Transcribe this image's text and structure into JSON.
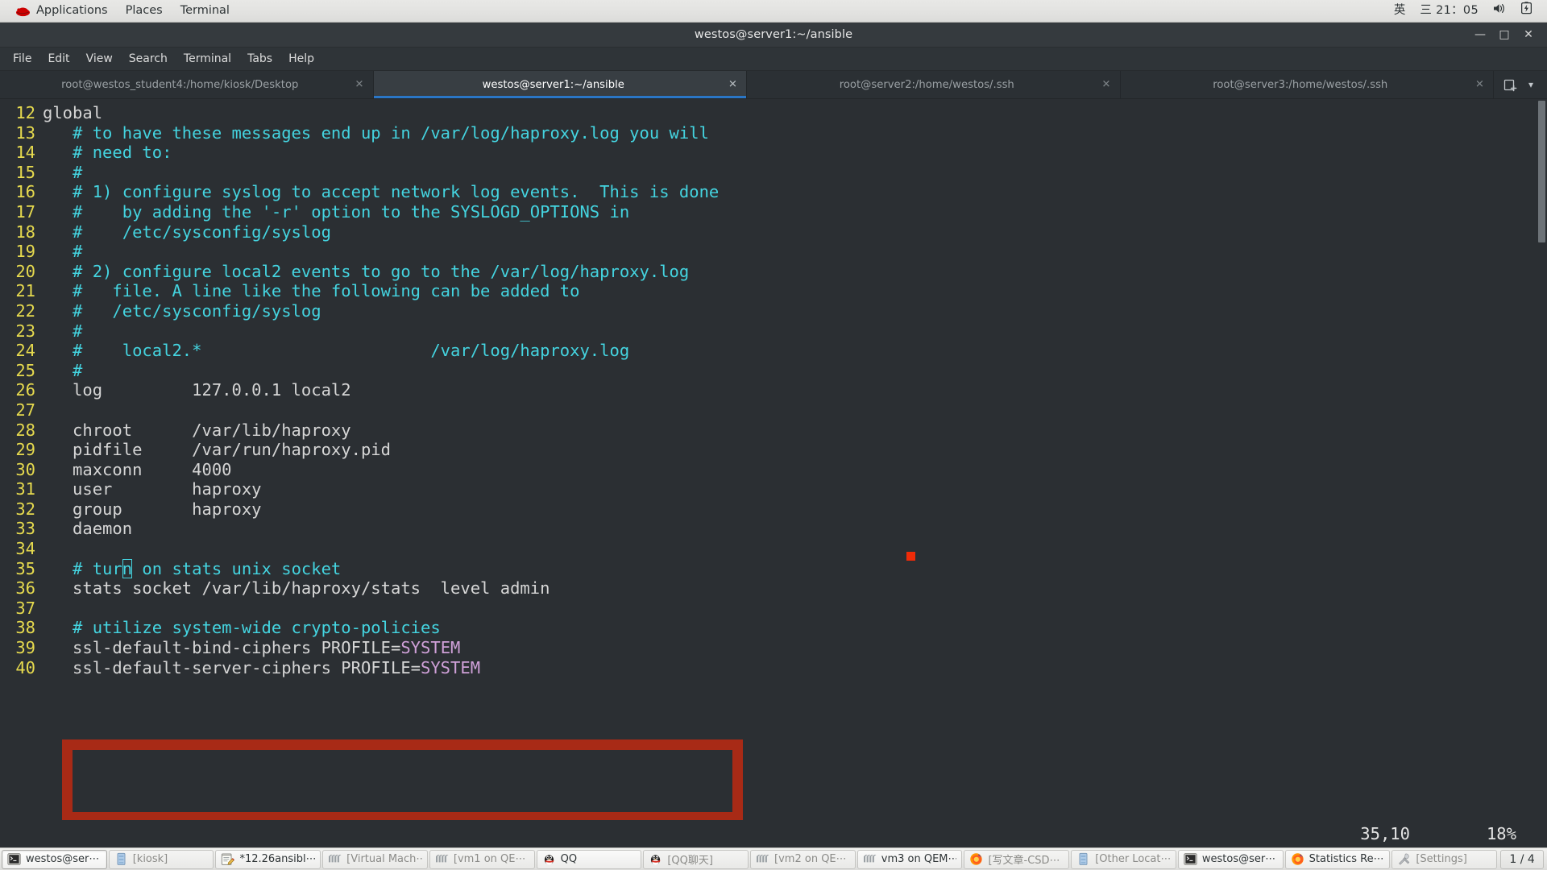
{
  "gnome_panel": {
    "left_items": [
      {
        "label": "Applications",
        "icon": "redhat-logo-icon"
      },
      {
        "label": "Places",
        "icon": null
      },
      {
        "label": "Terminal",
        "icon": null
      }
    ],
    "right_items": [
      {
        "label": "英",
        "icon": "input-method-icon"
      },
      {
        "label": "三 21：05",
        "icon": "calendar-clock-icon"
      },
      {
        "label": "",
        "icon": "volume-icon"
      },
      {
        "label": "",
        "icon": "battery-icon"
      }
    ]
  },
  "window": {
    "title": "westos@server1:~/ansible",
    "buttons": [
      {
        "name": "minimize",
        "glyph": "—"
      },
      {
        "name": "maximize",
        "glyph": "□"
      },
      {
        "name": "close",
        "glyph": "✕"
      }
    ]
  },
  "menubar": {
    "items": [
      "File",
      "Edit",
      "View",
      "Search",
      "Terminal",
      "Tabs",
      "Help"
    ]
  },
  "tabs": {
    "close_glyph": "✕",
    "items": [
      {
        "label": "root@westos_student4:/home/kiosk/Desktop",
        "active": false
      },
      {
        "label": "westos@server1:~/ansible",
        "active": true
      },
      {
        "label": "root@server2:/home/westos/.ssh",
        "active": false
      },
      {
        "label": "root@server3:/home/westos/.ssh",
        "active": false
      }
    ],
    "controls": [
      {
        "name": "new-tab-icon",
        "glyph": "❐"
      },
      {
        "name": "tab-list-chevron-down-icon",
        "glyph": "▾"
      }
    ]
  },
  "editor": {
    "colors": {
      "line_number": "#e6da4e",
      "comment": "#44d4e0",
      "text": "#d6d6d6",
      "constant": "#cfa0d8",
      "background": "#2b2f33",
      "annotation_red": "#a82a16",
      "annotation_dot": "#ef2b08"
    },
    "lines": [
      {
        "n": "12",
        "parts": [
          {
            "t": "global",
            "c": "plain"
          }
        ]
      },
      {
        "n": "13",
        "parts": [
          {
            "t": "   # to have these messages end up in /var/log/haproxy.log you will",
            "c": "comment"
          }
        ]
      },
      {
        "n": "14",
        "parts": [
          {
            "t": "   # need to:",
            "c": "comment"
          }
        ]
      },
      {
        "n": "15",
        "parts": [
          {
            "t": "   #",
            "c": "comment"
          }
        ]
      },
      {
        "n": "16",
        "parts": [
          {
            "t": "   # 1) configure syslog to accept network log events.  This is done",
            "c": "comment"
          }
        ]
      },
      {
        "n": "17",
        "parts": [
          {
            "t": "   #    by adding the '-r' option to the SYSLOGD_OPTIONS in",
            "c": "comment"
          }
        ]
      },
      {
        "n": "18",
        "parts": [
          {
            "t": "   #    /etc/sysconfig/syslog",
            "c": "comment"
          }
        ]
      },
      {
        "n": "19",
        "parts": [
          {
            "t": "   #",
            "c": "comment"
          }
        ]
      },
      {
        "n": "20",
        "parts": [
          {
            "t": "   # 2) configure local2 events to go to the /var/log/haproxy.log",
            "c": "comment"
          }
        ]
      },
      {
        "n": "21",
        "parts": [
          {
            "t": "   #   file. A line like the following can be added to",
            "c": "comment"
          }
        ]
      },
      {
        "n": "22",
        "parts": [
          {
            "t": "   #   /etc/sysconfig/syslog",
            "c": "comment"
          }
        ]
      },
      {
        "n": "23",
        "parts": [
          {
            "t": "   #",
            "c": "comment"
          }
        ]
      },
      {
        "n": "24",
        "parts": [
          {
            "t": "   #    local2.*                       /var/log/haproxy.log",
            "c": "comment"
          }
        ]
      },
      {
        "n": "25",
        "parts": [
          {
            "t": "   #",
            "c": "comment"
          }
        ]
      },
      {
        "n": "26",
        "parts": [
          {
            "t": "   log         127.0.0.1 local2",
            "c": "plain"
          }
        ]
      },
      {
        "n": "27",
        "parts": [
          {
            "t": "",
            "c": "plain"
          }
        ]
      },
      {
        "n": "28",
        "parts": [
          {
            "t": "   chroot      /var/lib/haproxy",
            "c": "plain"
          }
        ]
      },
      {
        "n": "29",
        "parts": [
          {
            "t": "   pidfile     /var/run/haproxy.pid",
            "c": "plain"
          }
        ]
      },
      {
        "n": "30",
        "parts": [
          {
            "t": "   maxconn     4000",
            "c": "plain"
          }
        ]
      },
      {
        "n": "31",
        "parts": [
          {
            "t": "   user        haproxy",
            "c": "plain"
          }
        ]
      },
      {
        "n": "32",
        "parts": [
          {
            "t": "   group       haproxy",
            "c": "plain"
          }
        ]
      },
      {
        "n": "33",
        "parts": [
          {
            "t": "   daemon",
            "c": "plain"
          }
        ]
      },
      {
        "n": "34",
        "parts": [
          {
            "t": "",
            "c": "plain"
          }
        ]
      },
      {
        "n": "35",
        "parts": [
          {
            "t": "   # tur",
            "c": "comment"
          },
          {
            "t": "n",
            "c": "cursor"
          },
          {
            "t": " on stats unix socket",
            "c": "comment"
          }
        ]
      },
      {
        "n": "36",
        "parts": [
          {
            "t": "   stats socket /var/lib/haproxy/stats  level admin",
            "c": "plain"
          }
        ]
      },
      {
        "n": "37",
        "parts": [
          {
            "t": "",
            "c": "plain"
          }
        ]
      },
      {
        "n": "38",
        "parts": [
          {
            "t": "   # utilize system-wide crypto-policies",
            "c": "comment"
          }
        ]
      },
      {
        "n": "39",
        "parts": [
          {
            "t": "   ssl-default-bind-ciphers PROFILE=",
            "c": "plain"
          },
          {
            "t": "SYSTEM",
            "c": "const"
          }
        ]
      },
      {
        "n": "40",
        "parts": [
          {
            "t": "   ssl-default-server-ciphers PROFILE=",
            "c": "plain"
          },
          {
            "t": "SYSTEM",
            "c": "const"
          }
        ]
      }
    ],
    "status": {
      "position": "35,10",
      "percent": "18%"
    }
  },
  "taskbar": {
    "items": [
      {
        "label": "westos@ser⋯",
        "icon": "terminal-icon",
        "state": "active"
      },
      {
        "label": "[kiosk]",
        "icon": "file-manager-icon",
        "state": "dim"
      },
      {
        "label": "*12.26ansibl⋯",
        "icon": "text-editor-icon",
        "state": "normal"
      },
      {
        "label": "[Virtual Mach⋯",
        "icon": "virt-manager-icon",
        "state": "dim"
      },
      {
        "label": "[vm1 on QE⋯",
        "icon": "virt-manager-icon",
        "state": "dim"
      },
      {
        "label": "QQ",
        "icon": "qq-penguin-icon",
        "state": "normal"
      },
      {
        "label": "[QQ聊天]",
        "icon": "qq-penguin-icon",
        "state": "dim"
      },
      {
        "label": "[vm2 on QE⋯",
        "icon": "virt-manager-icon",
        "state": "dim"
      },
      {
        "label": "vm3 on QEM⋯",
        "icon": "virt-manager-icon",
        "state": "normal"
      },
      {
        "label": "[写文章-CSD⋯",
        "icon": "firefox-icon",
        "state": "dim"
      },
      {
        "label": "[Other Locat⋯",
        "icon": "file-manager-icon",
        "state": "dim"
      },
      {
        "label": "westos@ser⋯",
        "icon": "terminal-icon",
        "state": "normal"
      },
      {
        "label": "Statistics Re⋯",
        "icon": "firefox-icon",
        "state": "normal"
      },
      {
        "label": "[Settings]",
        "icon": "tools-icon",
        "state": "dim"
      }
    ],
    "workspace": "1 / 4"
  }
}
